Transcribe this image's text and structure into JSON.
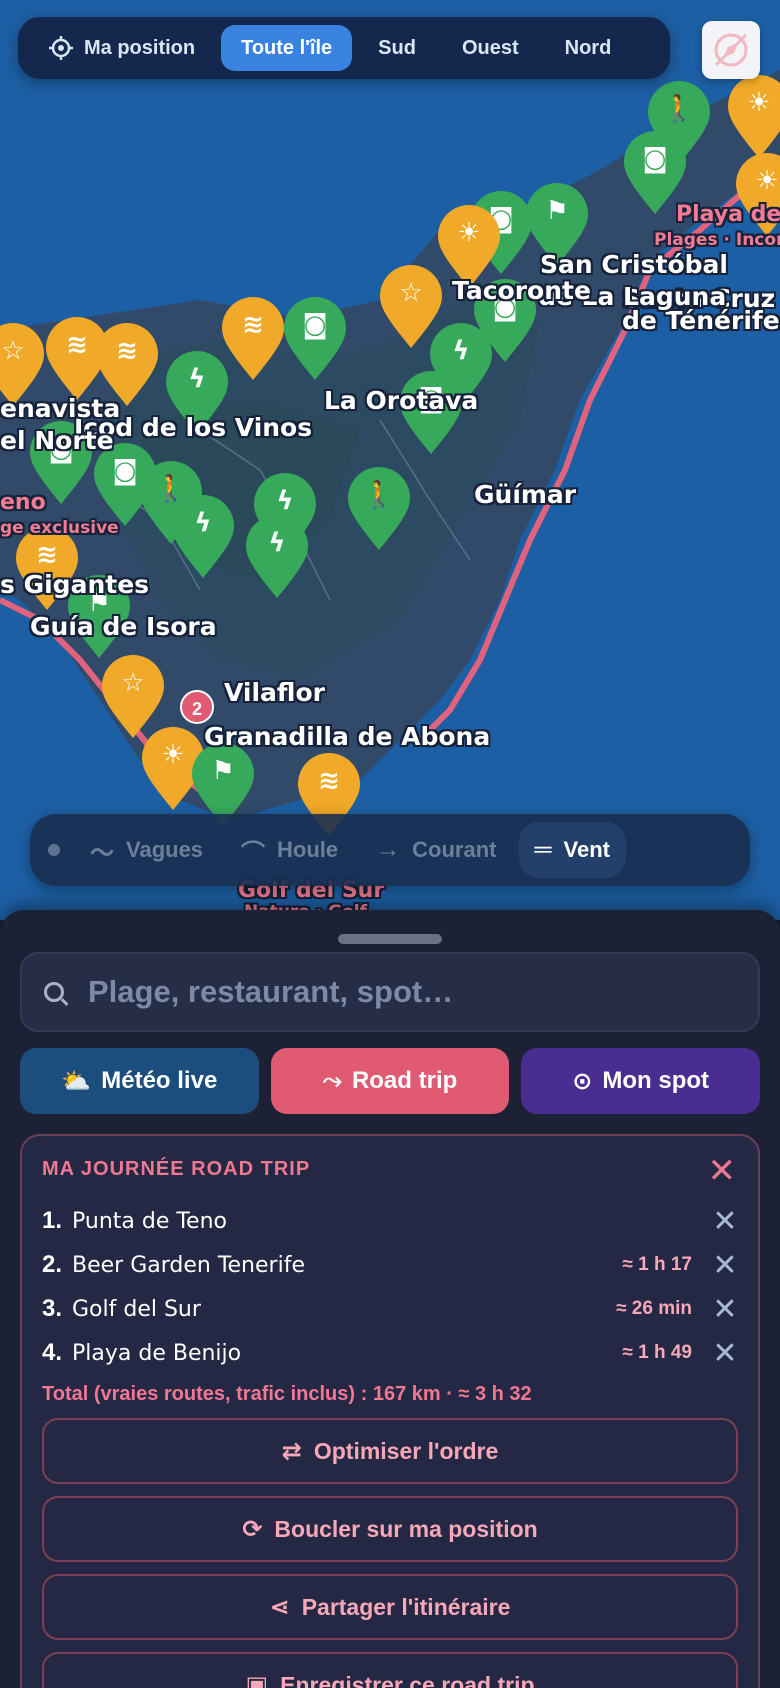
{
  "topbar": {
    "position_label": "Ma position",
    "tabs": [
      {
        "label": "Toute l'île",
        "active": true
      },
      {
        "label": "Sud",
        "active": false
      },
      {
        "label": "Ouest",
        "active": false
      },
      {
        "label": "Nord",
        "active": false
      }
    ],
    "compass_icon": "compass-off-icon"
  },
  "map": {
    "places": {
      "santa_cruz_1": "Santa Cruz",
      "santa_cruz_2": "de Ténérife",
      "san_cristobal_1": "San Cristóbal",
      "san_cristobal_2": "de La Laguna",
      "tacoronte": "Tacoronte",
      "la_orotava": "La Orotava",
      "icod": "Icod de los Vinos",
      "buenavista_1": "enavista",
      "buenavista_2": "el Norte",
      "guimar": "Güímar",
      "gigantes": "s Gigantes",
      "guia": "Guía de Isora",
      "vilaflor": "Vilaflor",
      "granadilla": "Granadilla de Abona",
      "playa_de": "Playa de I",
      "playas_sub": "Plages · Incont",
      "teno": "eno",
      "teno_sub": "ge exclusive",
      "golf": "Golf del Sur",
      "golf_sub": "Nature · Golf",
      "cluster_count": "2"
    }
  },
  "layers": {
    "items": [
      {
        "label": "Vagues",
        "icon": "wave-icon",
        "active": false
      },
      {
        "label": "Houle",
        "icon": "swell-icon",
        "active": false
      },
      {
        "label": "Courant",
        "icon": "arrow-right-icon",
        "active": false
      },
      {
        "label": "Vent",
        "icon": "wind-icon",
        "active": true
      }
    ]
  },
  "search": {
    "placeholder": "Plage, restaurant, spot…"
  },
  "actions": {
    "meteo": "Météo live",
    "road_trip": "Road trip",
    "mon_spot": "Mon spot"
  },
  "road_trip": {
    "title": "MA JOURNÉE ROAD TRIP",
    "stops": [
      {
        "num": "1.",
        "name": "Punta de Teno",
        "duration": ""
      },
      {
        "num": "2.",
        "name": "Beer Garden Tenerife",
        "duration": "≈ 1 h 17"
      },
      {
        "num": "3.",
        "name": "Golf del Sur",
        "duration": "≈ 26 min"
      },
      {
        "num": "4.",
        "name": "Playa de Benijo",
        "duration": "≈ 1 h 49"
      }
    ],
    "total": "Total (vraies routes, trafic inclus) : 167 km · ≈ 3 h 32",
    "optimize": "Optimiser l'ordre",
    "loop": "Boucler sur ma position",
    "share": "Partager l'itinéraire",
    "save": "Enregistrer ce road trip"
  },
  "colors": {
    "map_water": "#1d5fa4",
    "island": "#324a6a",
    "pin_green": "#37a95a",
    "pin_orange": "#f0a928",
    "accent_pink": "#e05a72",
    "accent_blue": "#3a82e0"
  }
}
